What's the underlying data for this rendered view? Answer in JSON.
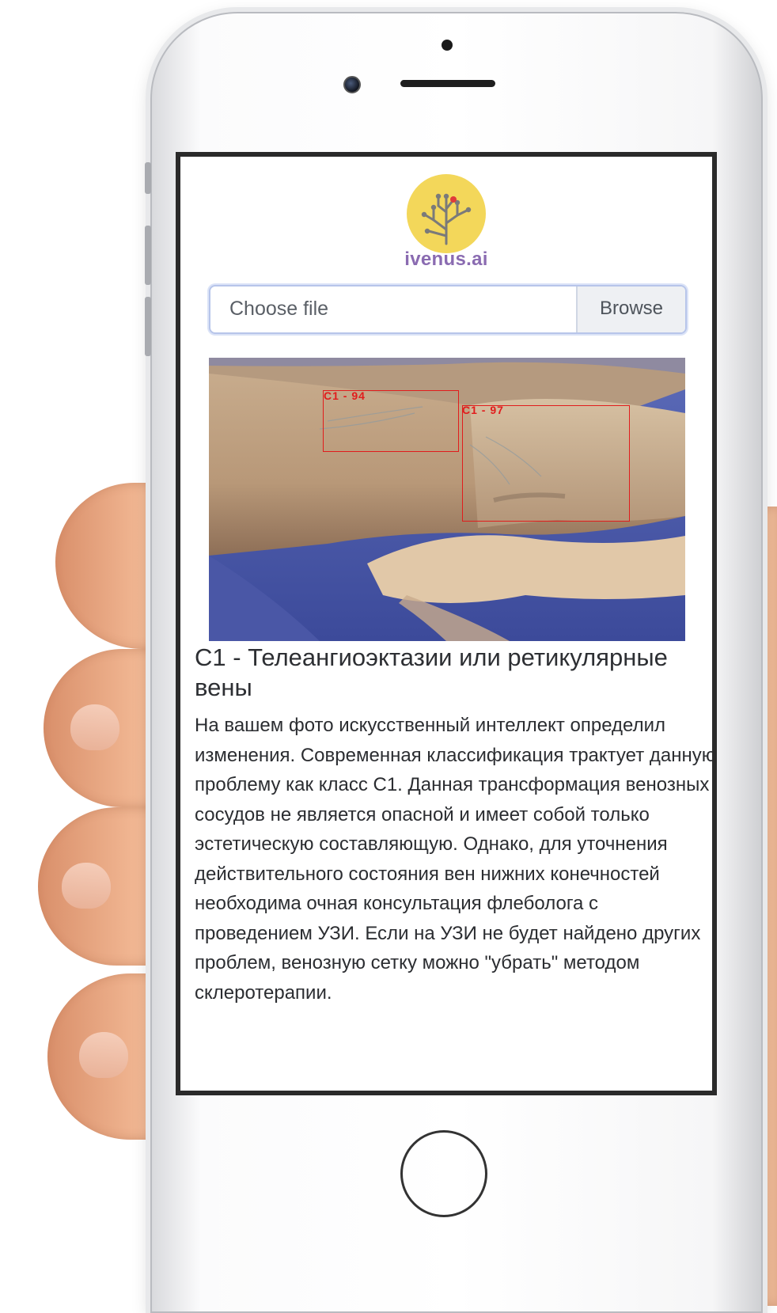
{
  "app": {
    "brand": "ivenus.ai"
  },
  "upload": {
    "placeholder": "Choose file",
    "browse_label": "Browse"
  },
  "photo": {
    "detections": [
      {
        "label": "C1 - 94"
      },
      {
        "label": "C1 - 97"
      }
    ]
  },
  "result": {
    "title": "C1 - Телеангиоэктазии или ретикулярные вены",
    "description": "На вашем фото искусственный интеллект определил изменения. Современная классификация трактует данную проблему как класс С1. Данная трансформация венозных сосудов не является опасной и имеет собой только эстетическую составляющую. Однако, для уточнения действительного состояния вен нижних конечностей необходима очная консультация флеболога с проведением УЗИ. Если на УЗИ не будет найдено других проблем, венозную сетку можно \"убрать\" методом склеротерапии."
  },
  "colors": {
    "logo_circle": "#f3d75a",
    "brand_text": "#8a6bb1",
    "detection_box": "#e11c1c"
  },
  "icons": [
    "tree-logo-icon",
    "camera-icon",
    "home-button-icon"
  ]
}
